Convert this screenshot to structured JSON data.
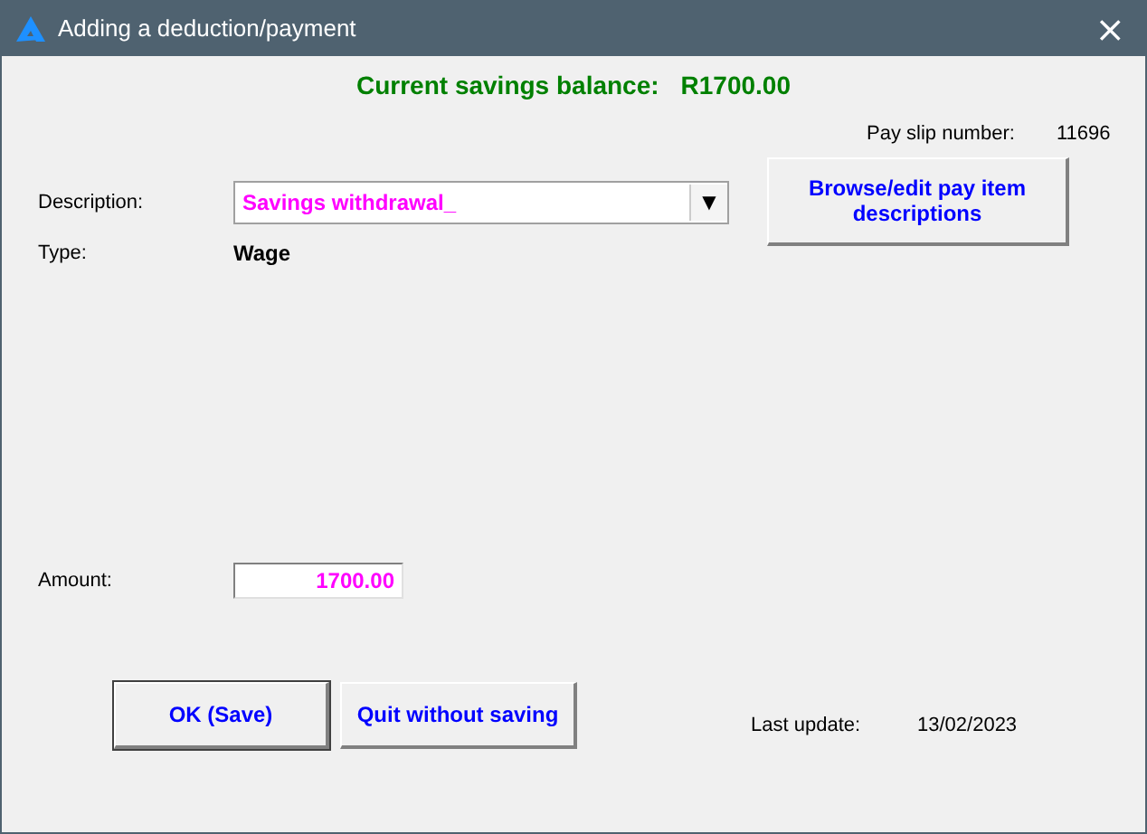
{
  "window": {
    "title": "Adding a deduction/payment",
    "close": "×"
  },
  "balance": {
    "label": "Current savings balance:",
    "value": "R1700.00"
  },
  "pay_slip": {
    "label": "Pay slip number:",
    "value": "11696"
  },
  "description": {
    "label": "Description:",
    "value": "Savings withdrawal_",
    "arrow": "▼"
  },
  "browse_button": "Browse/edit pay item descriptions",
  "type": {
    "label": "Type:",
    "value": "Wage"
  },
  "amount": {
    "label": "Amount:",
    "value": "1700.00"
  },
  "buttons": [
    {
      "label": "OK (Save)",
      "kind": "default"
    },
    {
      "label": "Quit without saving",
      "kind": "normal"
    }
  ],
  "last_update": {
    "label": "Last update:",
    "value": "13/02/2023"
  }
}
